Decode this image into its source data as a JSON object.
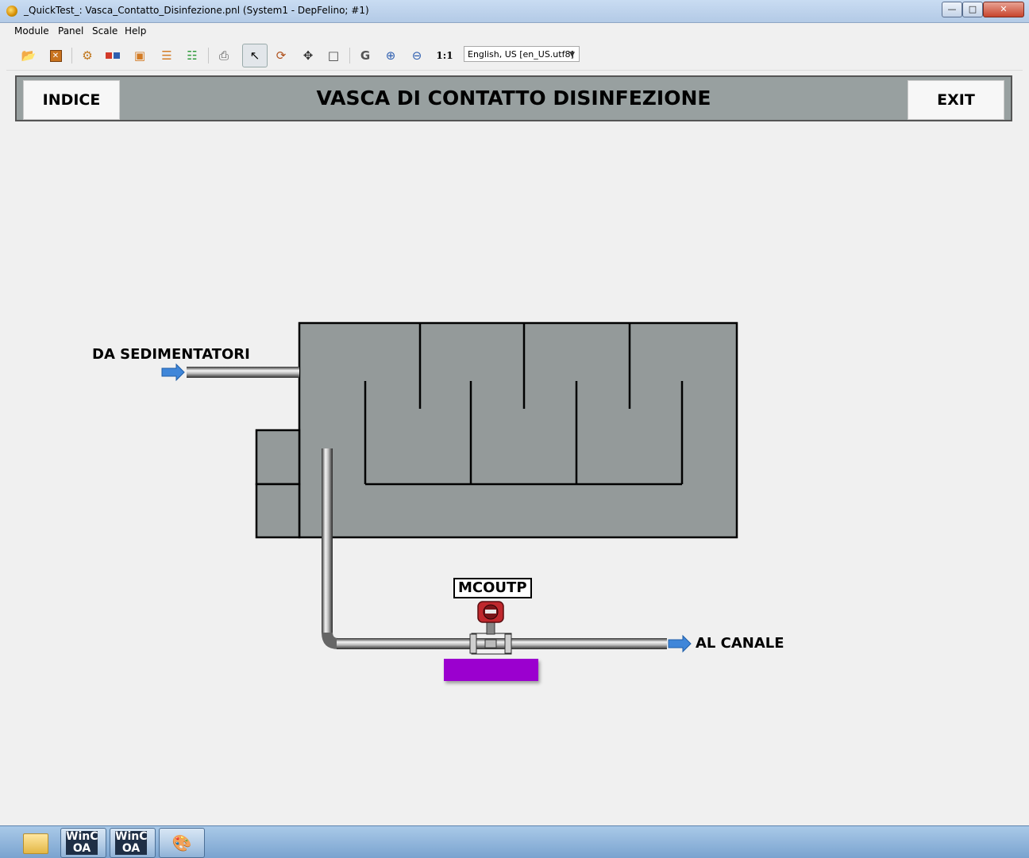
{
  "window": {
    "title": "_QuickTest_: Vasca_Contatto_Disinfezione.pnl (System1 - DepFelino; #1)",
    "min_glyph": "—",
    "max_glyph": "□",
    "close_glyph": "✕"
  },
  "menu": {
    "module": "Module",
    "panel": "Panel",
    "scale": "Scale",
    "help": "Help"
  },
  "toolbar": {
    "zoom_reset_label": "1:1",
    "language_value": "English, US [en_US.utf8]",
    "icons": [
      "open-folder-icon",
      "close-module-icon",
      "settings-gear-icon",
      "tree-view-icon",
      "paste-icon",
      "hierarchy-icon",
      "network-icon",
      "print-icon",
      "pointer-icon",
      "rotate-icon",
      "move-icon",
      "crop-icon",
      "gedi-icon",
      "zoom-in-icon",
      "zoom-out-icon",
      "zoom-reset-icon"
    ]
  },
  "panel": {
    "title": "VASCA DI CONTATTO DISINFEZIONE",
    "indice_label": "INDICE",
    "exit_label": "EXIT",
    "inlet_label": "DA SEDIMENTATORI",
    "outlet_label": "AL CANALE",
    "sensor_tag": "MCOUTP",
    "colors": {
      "header": "#98a0a0",
      "tank": "#949a9a",
      "value_box": "#9b00cf",
      "flow_arrow": "#3f86d9",
      "sensor_red": "#c0282d"
    }
  },
  "taskbar": {
    "items": [
      {
        "name": "explorer",
        "label": ""
      },
      {
        "name": "winccoa-1",
        "label": "WinC OA"
      },
      {
        "name": "winccoa-2",
        "label": "WinC OA"
      },
      {
        "name": "paint",
        "label": ""
      }
    ],
    "winccoa_1_label": "WinC OA",
    "winccoa_2_label": "WinC OA"
  }
}
